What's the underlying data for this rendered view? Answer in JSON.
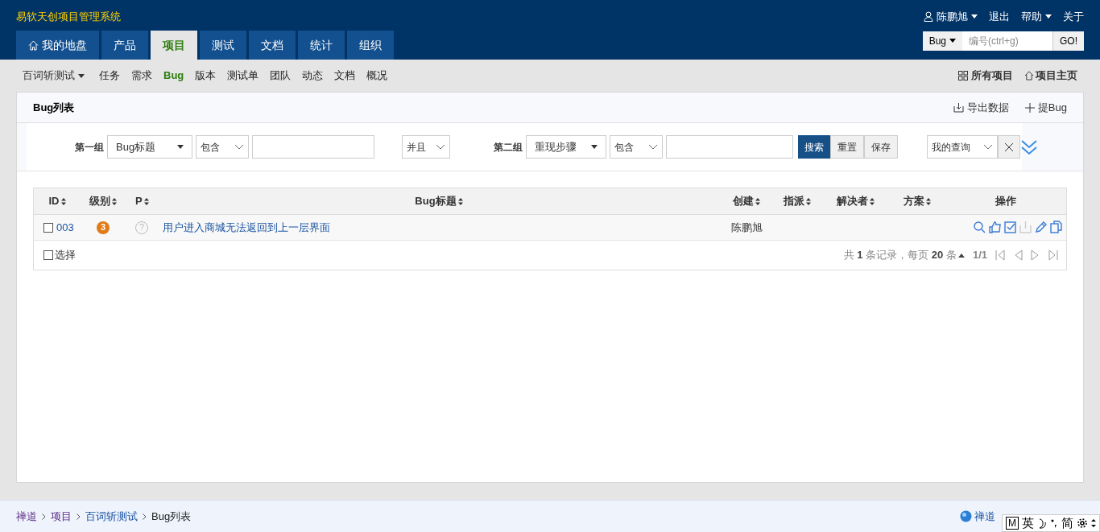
{
  "app_title": "易软天创项目管理系统",
  "user_menu": {
    "user": "陈鹏旭",
    "logout": "退出",
    "help": "帮助",
    "about": "关于"
  },
  "quick_jump": {
    "type": "Bug",
    "placeholder": "编号(ctrl+g)",
    "button": "GO!"
  },
  "main_tabs": [
    {
      "label": "我的地盘",
      "selected": false
    },
    {
      "label": "产品",
      "selected": false
    },
    {
      "label": "项目",
      "selected": true
    },
    {
      "label": "测试",
      "selected": false
    },
    {
      "label": "文档",
      "selected": false
    },
    {
      "label": "统计",
      "selected": false
    },
    {
      "label": "组织",
      "selected": false
    }
  ],
  "project_switcher": "百词斩测试",
  "sub_nav": [
    {
      "label": "任务",
      "selected": false
    },
    {
      "label": "需求",
      "selected": false
    },
    {
      "label": "Bug",
      "selected": true
    },
    {
      "label": "版本",
      "selected": false
    },
    {
      "label": "测试单",
      "selected": false
    },
    {
      "label": "团队",
      "selected": false
    },
    {
      "label": "动态",
      "selected": false
    },
    {
      "label": "文档",
      "selected": false
    },
    {
      "label": "概况",
      "selected": false
    }
  ],
  "sub_nav_right": {
    "all_projects": "所有项目",
    "project_home": "项目主页"
  },
  "panel": {
    "title": "Bug列表",
    "export": "导出数据",
    "report": "提Bug"
  },
  "search": {
    "group1_label": "第一组",
    "group1_field": "Bug标题",
    "group1_op": "包含",
    "and_or": "并且",
    "group2_label": "第二组",
    "group2_field": "重现步骤",
    "group2_op": "包含",
    "search_button": "搜索",
    "reset_button": "重置",
    "save_button": "保存",
    "my_query": "我的查询"
  },
  "table": {
    "columns": [
      "ID",
      "级别",
      "P",
      "Bug标题",
      "创建",
      "指派",
      "解决者",
      "方案",
      "操作"
    ],
    "rows": [
      {
        "checked": false,
        "id": "003",
        "severity": "3",
        "priority": "?",
        "title": "用户进入商城无法返回到上一层界面",
        "creator": "陈鹏旭"
      }
    ],
    "select_all": {
      "label": "选择",
      "checked": false
    },
    "pager": {
      "summary": "共 **1** 条记录，每页 **20** 条",
      "page": "1/1"
    }
  },
  "breadcrumb": [
    "禅道",
    "项目",
    "百词斩测试",
    "Bug列表"
  ],
  "footer": {
    "version": "禅道"
  },
  "ime_bar": {
    "mode": "M",
    "lang": "英",
    "script": "简"
  }
}
